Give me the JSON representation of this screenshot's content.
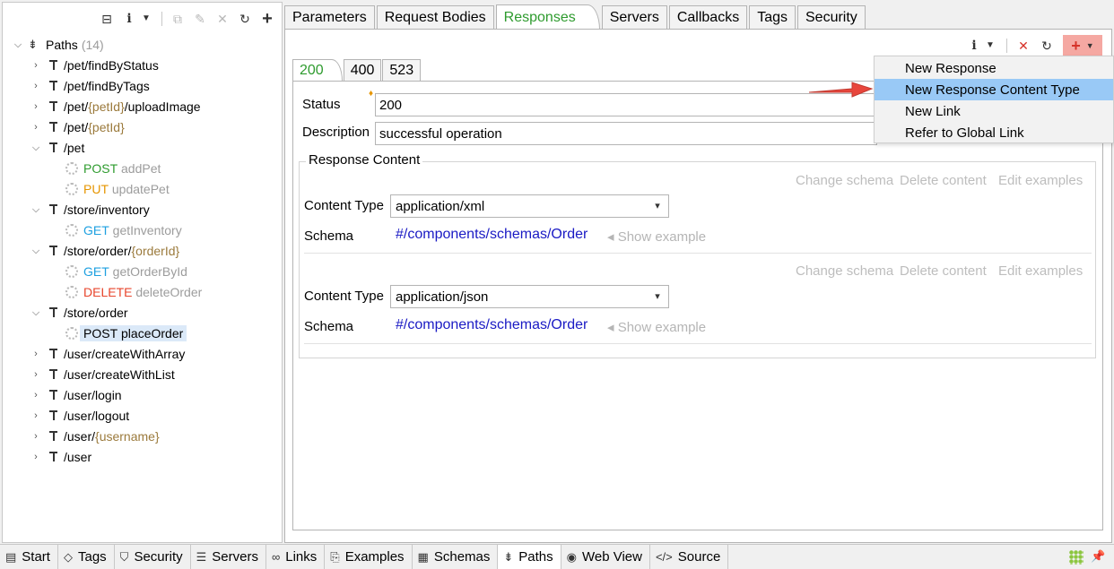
{
  "tree": {
    "root_label": "Paths",
    "root_count": "(14)",
    "toolbar_icons": [
      "collapse-all-icon",
      "info-icon",
      "dropdown-icon",
      "copy-icon",
      "edit-icon",
      "delete-icon",
      "refresh-icon",
      "add-icon"
    ],
    "items": [
      {
        "text": "/pet/findByStatus"
      },
      {
        "text": "/pet/findByTags"
      },
      {
        "pre": "/pet/",
        "param": "{petId}",
        "post": "/uploadImage"
      },
      {
        "pre": "/pet/",
        "param": "{petId}",
        "post": ""
      },
      {
        "text": "/pet"
      },
      {
        "method": "POST",
        "op": "addPet"
      },
      {
        "method": "PUT",
        "op": "updatePet"
      },
      {
        "text": "/store/inventory"
      },
      {
        "method": "GET",
        "op": "getInventory"
      },
      {
        "pre": "/store/order/",
        "param": "{orderId}",
        "post": ""
      },
      {
        "method": "GET",
        "op": "getOrderById"
      },
      {
        "method": "DELETE",
        "op": "deleteOrder"
      },
      {
        "text": "/store/order"
      },
      {
        "method": "POST",
        "op": "placeOrder"
      },
      {
        "text": "/user/createWithArray"
      },
      {
        "text": "/user/createWithList"
      },
      {
        "text": "/user/login"
      },
      {
        "text": "/user/logout"
      },
      {
        "pre": "/user/",
        "param": "{username}",
        "post": ""
      },
      {
        "text": "/user"
      }
    ]
  },
  "tabs": [
    "Parameters",
    "Request Bodies",
    "Responses",
    "Servers",
    "Callbacks",
    "Tags",
    "Security"
  ],
  "response_tabs": [
    "200",
    "400",
    "523"
  ],
  "form": {
    "status_label": "Status",
    "status_value": "200",
    "description_label": "Description",
    "description_value": "successful operation",
    "group_title": "Response Content",
    "actions": [
      "Change schema",
      "Delete content",
      "Edit examples"
    ],
    "content_type_label": "Content Type",
    "schema_label": "Schema",
    "show_example": "Show example",
    "contents": [
      {
        "content_type": "application/xml",
        "schema": "#/components/schemas/Order"
      },
      {
        "content_type": "application/json",
        "schema": "#/components/schemas/Order"
      }
    ]
  },
  "menu": {
    "items": [
      "New Response",
      "New Response Content Type",
      "New Link",
      "Refer to Global Link"
    ],
    "highlighted": "New Response Content Type"
  },
  "bottom_tabs": [
    "Start",
    "Tags",
    "Security",
    "Servers",
    "Links",
    "Examples",
    "Schemas",
    "Paths",
    "Web View",
    "Source"
  ],
  "colors": {
    "accent": "#2e9b2e",
    "highlight": "#99c9f6",
    "arrow": "#e8463c",
    "link": "#1a1ac4"
  }
}
